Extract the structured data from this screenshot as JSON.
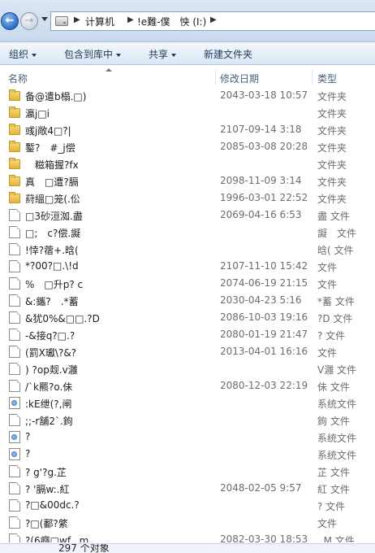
{
  "address": {
    "crumbs": [
      "计算机",
      "!e難-僕　怏 (I:)"
    ]
  },
  "toolbar": {
    "organize": "组织",
    "include_library": "包含到库中",
    "share": "共享",
    "new_folder": "新建文件夹"
  },
  "columns": {
    "name": "名称",
    "date": "修改日期",
    "type": "类型"
  },
  "files": [
    {
      "icon": "folder-icon",
      "name": "备@遣b榻.□)",
      "date": "2043-03-18 10:57",
      "type": "文件夹"
    },
    {
      "icon": "folder-icon",
      "name": "瀛j□i",
      "date": "",
      "type": "文件夹"
    },
    {
      "icon": "folder-icon",
      "name": "彧j敞4□?|",
      "date": "2107-09-14 3:18",
      "type": "文件夹"
    },
    {
      "icon": "folder-icon",
      "name": "鏨?　#_j偿",
      "date": "2085-03-08 20:28",
      "type": "文件夹"
    },
    {
      "icon": "folder-icon",
      "name": "　糍箱握?fx",
      "date": "",
      "type": "文件夹"
    },
    {
      "icon": "folder-icon",
      "name": "真　□遭?膈",
      "date": "2098-11-09 3:14",
      "type": "文件夹"
    },
    {
      "icon": "folder-icon",
      "name": "葤縕□笼(.伀",
      "date": "1996-03-01 22:52",
      "type": "文件夹"
    },
    {
      "icon": "file-icon",
      "name": "□3砂洹洳.盡",
      "date": "2069-04-16 6:53",
      "type": "盡 文件"
    },
    {
      "icon": "file-icon",
      "name": "□;　c?偿.譺",
      "date": "",
      "type": "譺　文件"
    },
    {
      "icon": "file-icon",
      "name": "!悻?蓿+.晗(",
      "date": "",
      "type": "晗( 文件"
    },
    {
      "icon": "file-icon",
      "name": "*?00?□.\\!d",
      "date": "2107-11-10 15:42",
      "type": "文件"
    },
    {
      "icon": "file-icon",
      "name": "%　□升p? c",
      "date": "2074-06-19 21:15",
      "type": "文件"
    },
    {
      "icon": "file-icon",
      "name": "&:鑴?　.*蓄",
      "date": "2030-04-23 5:16",
      "type": "*蓄 文件"
    },
    {
      "icon": "file-icon",
      "name": "&犹0%&□□.?D",
      "date": "2086-10-03 19:16",
      "type": "?D 文件"
    },
    {
      "icon": "file-icon",
      "name": "-&接q?□.?",
      "date": "2080-01-19 21:47",
      "type": "? 文件"
    },
    {
      "icon": "file-icon",
      "name": "(罰X瓛\\?&?",
      "date": "2013-04-01 16:16",
      "type": "文件"
    },
    {
      "icon": "file-icon",
      "name": ") ?op觌.v灉",
      "date": "",
      "type": "V灉 文件"
    },
    {
      "icon": "file-icon",
      "name": "/`k羆?o.佅",
      "date": "2080-12-03 22:19",
      "type": "佅 文件"
    },
    {
      "icon": "system-file-icon",
      "name": ":kE绁(?,闸",
      "date": "",
      "type": "系统文件"
    },
    {
      "icon": "file-icon",
      "name": ";;-r舗2`.鉤",
      "date": "",
      "type": "鉤 文件"
    },
    {
      "icon": "system-file-icon",
      "name": "?",
      "date": "",
      "type": "系统文件"
    },
    {
      "icon": "system-file-icon",
      "name": "?",
      "date": "",
      "type": "系统文件"
    },
    {
      "icon": "file-icon",
      "name": "? g'?g.芷",
      "date": "",
      "type": "芷 文件"
    },
    {
      "icon": "file-icon",
      "name": "? '膈w:.紅",
      "date": "2048-02-05 9:57",
      "type": "紅 文件"
    },
    {
      "icon": "file-icon",
      "name": "?□&00dc.?",
      "date": "",
      "type": "? 文件"
    },
    {
      "icon": "file-icon",
      "name": "?□(鄱?綮",
      "date": "",
      "type": "文件"
    },
    {
      "icon": "file-icon",
      "name": "?(6癮□wf...m",
      "date": "2082-03-30 18:53",
      "type": "..M 文件"
    }
  ],
  "status": {
    "count": "297 个对象"
  }
}
